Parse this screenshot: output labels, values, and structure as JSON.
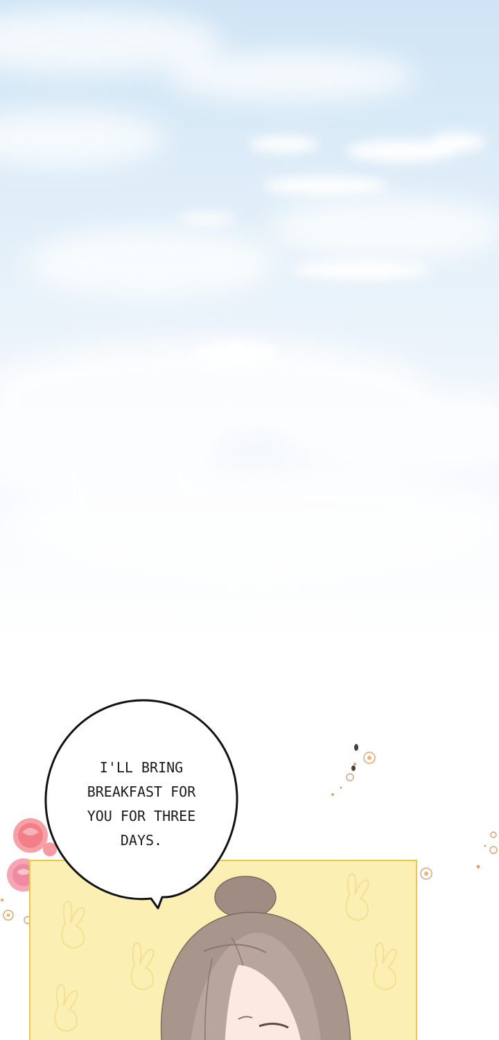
{
  "speech_bubble": {
    "lines": [
      "I'LL BRING",
      "BREAKFAST FOR",
      "YOU FOR THREE",
      "DAYS."
    ]
  },
  "colors": {
    "sky_top": "#cfe4f5",
    "sky_bottom": "#ffffff",
    "panel_fill": "#fbefb4",
    "panel_border": "#f2c54a",
    "hair": "#a48f86",
    "rose": "#f48a8e",
    "leaf": "#8fd0c0"
  },
  "icons": [
    "rose-icon",
    "flower-icon",
    "bunny-pattern-icon"
  ]
}
